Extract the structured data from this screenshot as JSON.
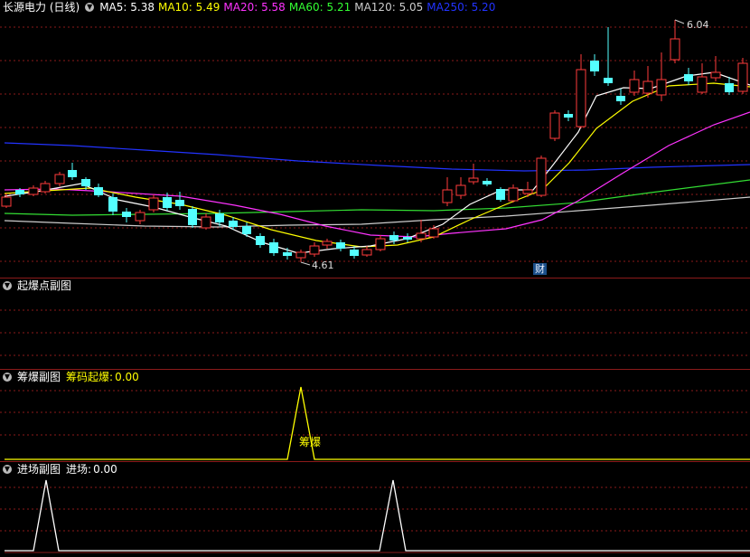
{
  "main": {
    "title": "长源电力 (日线)",
    "ma": [
      {
        "label": "MA5:",
        "value": "5.38",
        "color": "#ffffff"
      },
      {
        "label": "MA10:",
        "value": "5.49",
        "color": "#ffff00"
      },
      {
        "label": "MA20:",
        "value": "5.58",
        "color": "#ff33ff"
      },
      {
        "label": "MA60:",
        "value": "5.21",
        "color": "#33ff33"
      },
      {
        "label": "MA120:",
        "value": "5.05",
        "color": "#cccccc"
      },
      {
        "label": "MA250:",
        "value": "5.20",
        "color": "#2233ff"
      }
    ],
    "high_label": "6.04",
    "low_label": "4.61",
    "cai_badge": "财"
  },
  "sub1": {
    "title": "起爆点副图"
  },
  "sub2": {
    "title": "筹爆副图",
    "indicator_label": "筹码起爆:",
    "indicator_value": "0.00",
    "peak_label": "筹爆"
  },
  "sub3": {
    "title": "进场副图",
    "indicator_label": "进场:",
    "indicator_value": "0.00"
  },
  "colors": {
    "up": "#ff3b3b",
    "down": "#54ffff",
    "grid": "#8c1a1a",
    "yellow": "#ffff00"
  }
}
